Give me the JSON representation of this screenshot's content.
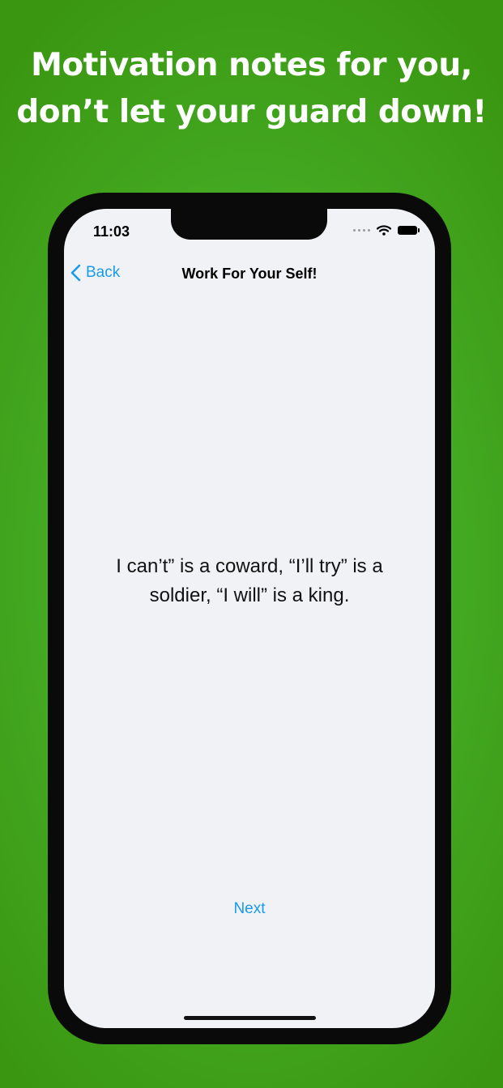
{
  "banner": {
    "line1": "Motivation notes for you,",
    "line2": "don’t let your guard down!"
  },
  "status_bar": {
    "time": "11:03",
    "icons": [
      "cellular-dots-icon",
      "wifi-icon",
      "battery-icon"
    ]
  },
  "nav": {
    "back_label": "Back",
    "title": "Work For Your Self!"
  },
  "note": {
    "text": "I can’t” is a coward, “I’ll try” is a soldier, “I will” is a king."
  },
  "footer": {
    "next_label": "Next"
  },
  "colors": {
    "background_green": "#46ad26",
    "accent_blue": "#1a9be8",
    "screen_bg": "#f1f2f6"
  }
}
